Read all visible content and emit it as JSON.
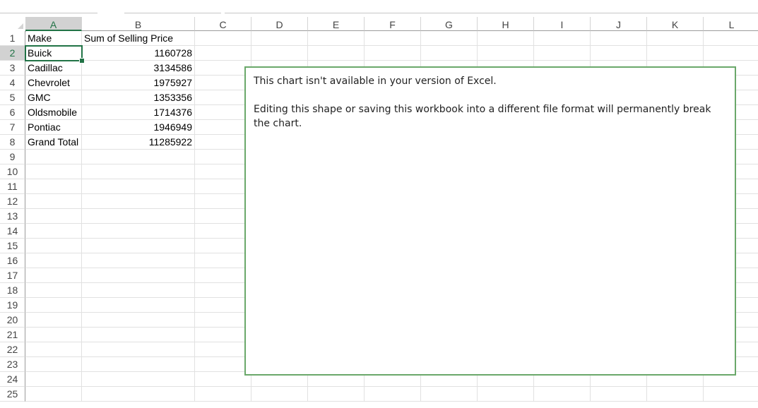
{
  "columns": [
    "A",
    "B",
    "C",
    "D",
    "E",
    "F",
    "G",
    "H",
    "I",
    "J",
    "K",
    "L"
  ],
  "rows": [
    "1",
    "2",
    "3",
    "4",
    "5",
    "6",
    "7",
    "8",
    "9",
    "10",
    "11",
    "12",
    "13",
    "14",
    "15",
    "16",
    "17",
    "18",
    "19",
    "20",
    "21",
    "22",
    "23",
    "24",
    "25"
  ],
  "table": {
    "headers": [
      "Make",
      "Sum of Selling Price"
    ],
    "rows": [
      {
        "make": "Buick",
        "price": "1160728"
      },
      {
        "make": "Cadillac",
        "price": "3134586"
      },
      {
        "make": "Chevrolet",
        "price": "1975927"
      },
      {
        "make": "GMC",
        "price": "1353356"
      },
      {
        "make": "Oldsmobile",
        "price": "1714376"
      },
      {
        "make": "Pontiac",
        "price": "1946949"
      },
      {
        "make": "Grand Total",
        "price": "11285922"
      }
    ]
  },
  "selected_cell": "A2",
  "chart_placeholder": {
    "line1": "This chart isn't available in your version of Excel.",
    "line2": "Editing this shape or saving this workbook into a different file format will permanently break the chart."
  },
  "colors": {
    "accent": "#217346",
    "chart_border": "#6aa86a"
  }
}
